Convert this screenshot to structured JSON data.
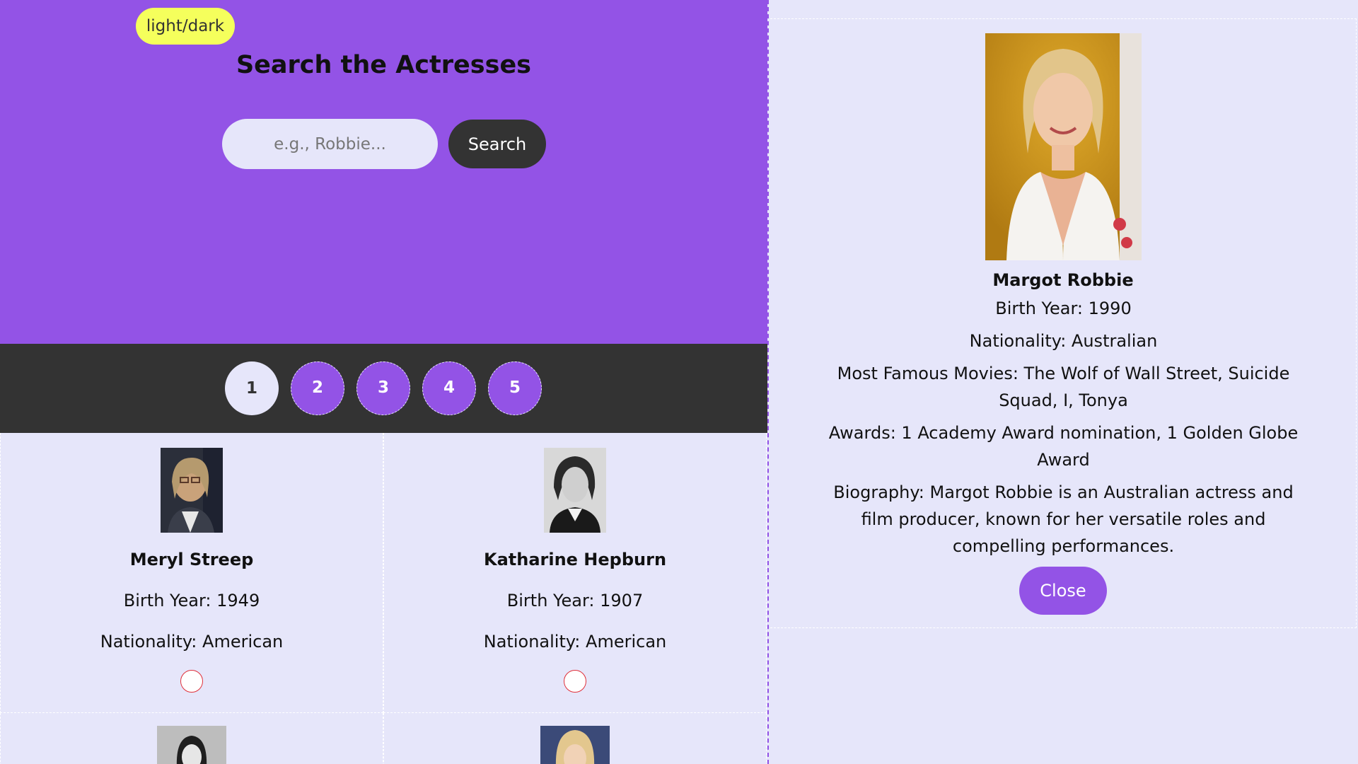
{
  "header": {
    "theme_toggle": "light/dark",
    "title": "Search the Actresses",
    "search_placeholder": "e.g., Robbie...",
    "search_button": "Search"
  },
  "pagination": {
    "pages": [
      "1",
      "2",
      "3",
      "4",
      "5"
    ],
    "active": "1"
  },
  "cards": [
    {
      "name": "Meryl Streep",
      "birth_year": "Birth Year: 1949",
      "nationality": "Nationality: American"
    },
    {
      "name": "Katharine Hepburn",
      "birth_year": "Birth Year: 1907",
      "nationality": "Nationality: American"
    }
  ],
  "detail": {
    "name": "Margot Robbie",
    "birth_year": "Birth Year: 1990",
    "nationality": "Nationality: Australian",
    "movies": "Most Famous Movies: The Wolf of Wall Street, Suicide Squad, I, Tonya",
    "awards": "Awards: 1 Academy Award nomination, 1 Golden Globe Award",
    "biography": "Biography: Margot Robbie is an Australian actress and film producer, known for her versatile roles and compelling performances.",
    "close_button": "Close"
  },
  "colors": {
    "accent": "#9353e6",
    "background": "#e6e6fa",
    "dark": "#333333",
    "toggle": "#f5ff5c"
  }
}
